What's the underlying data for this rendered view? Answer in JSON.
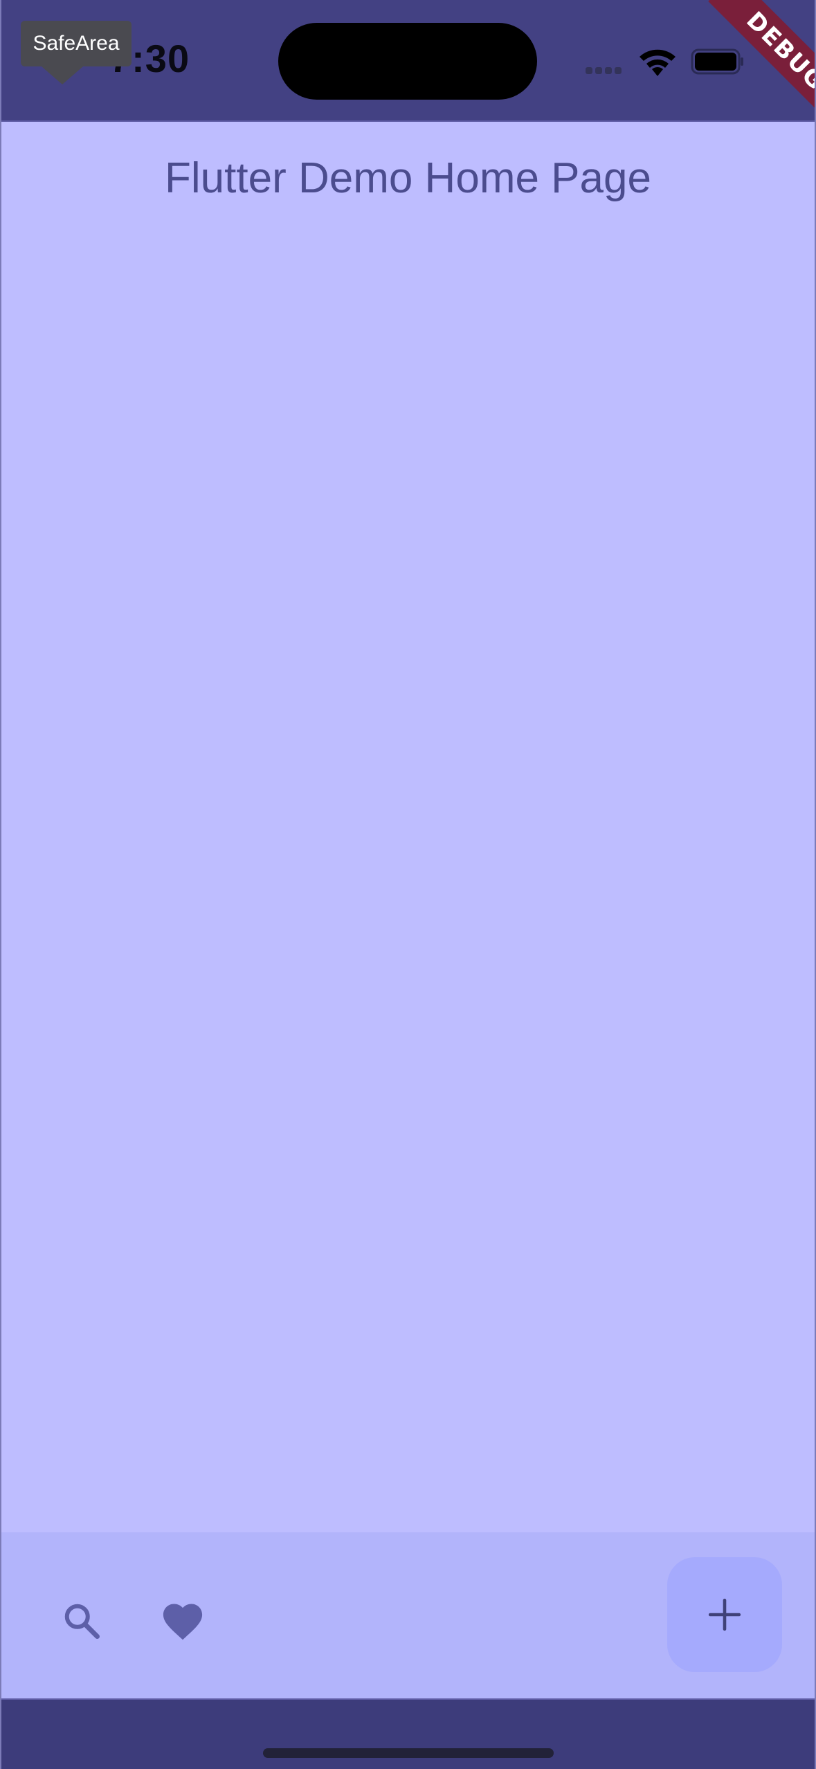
{
  "status_bar": {
    "time": "7:30"
  },
  "overlay": {
    "safearea_label": "SafeArea",
    "debug_label": "DEBUG"
  },
  "app": {
    "title": "Flutter Demo Home Page"
  },
  "bottom_bar": {
    "icons": [
      "search-icon",
      "heart-icon"
    ],
    "fab_icon": "plus-icon"
  },
  "colors": {
    "background": "#bebdff",
    "status_bar": "#434183",
    "bottom_bar": "#b2b4fb",
    "fab": "#a5aafd",
    "title_text": "#4b4c8e",
    "icon": "#5d5fa8",
    "debug_ribbon": "#7a1f3a"
  }
}
